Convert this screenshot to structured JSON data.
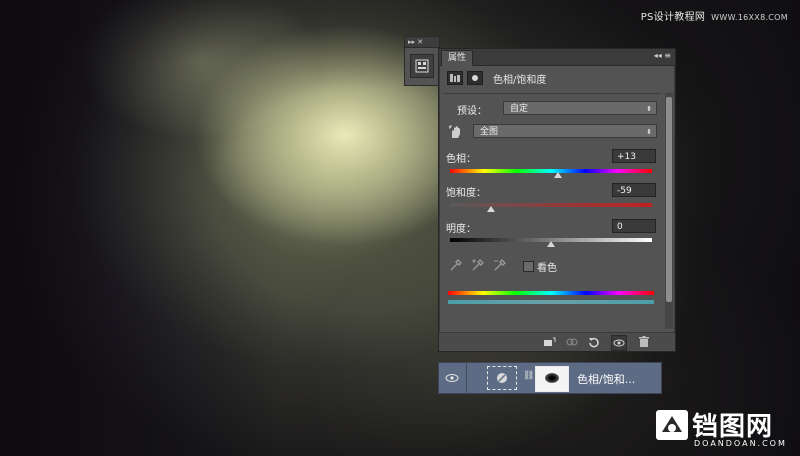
{
  "watermark_top": {
    "text": "PS设计教程网",
    "site": "WWW.16XX8.COM"
  },
  "mini_panel": {
    "controls": "▸▸ ✕"
  },
  "properties_panel": {
    "tab_label": "属性",
    "title_controls": "◂◂ ≡",
    "header_title": "色相/饱和度",
    "preset_label": "预设：",
    "preset_value": "自定",
    "channel_value": "全图",
    "hue_label": "色相：",
    "hue_value": "+13",
    "saturation_label": "饱和度：",
    "saturation_value": "-59",
    "lightness_label": "明度：",
    "lightness_value": "0",
    "colorize_label": "看色",
    "hue_fraction": 0.537,
    "saturation_fraction": 0.205,
    "lightness_fraction": 0.5
  },
  "layer": {
    "name": "色相/饱和...",
    "selected_color": "#5d6b84"
  },
  "logo": {
    "cn": "铛图网",
    "en": "DOANDOAN.COM"
  },
  "colors": {
    "panel_bg": "#535353",
    "panel_dark": "#3b3b3b",
    "saturation_track": "#c02020"
  }
}
